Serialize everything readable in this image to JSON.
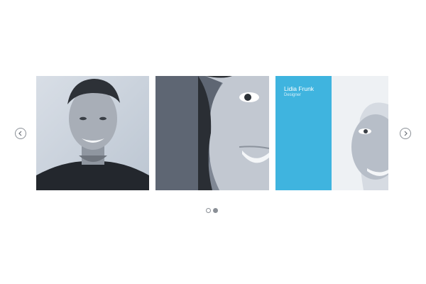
{
  "carousel": {
    "icons": {
      "prev": "chevron-left-icon",
      "next": "chevron-right-icon"
    },
    "cards": [
      {
        "name": "",
        "role": ""
      },
      {
        "name": "",
        "role": ""
      },
      {
        "name": "Lidia Frunk",
        "role": "Designer"
      }
    ],
    "pagination": {
      "count": 2,
      "active_index": 1
    },
    "colors": {
      "accent": "#3fb4df",
      "control": "#8a8f96"
    }
  }
}
